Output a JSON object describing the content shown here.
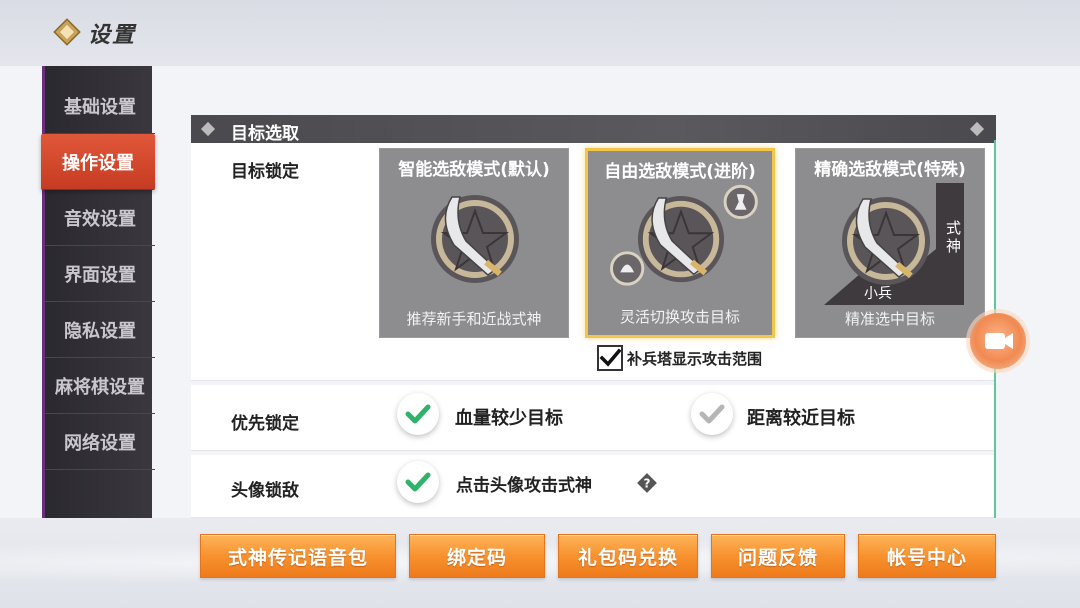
{
  "header": {
    "title": "设置",
    "logo_icon": "diamond-logo-icon"
  },
  "sidebar": {
    "items": [
      {
        "label": "基础设置",
        "active": false
      },
      {
        "label": "操作设置",
        "active": true
      },
      {
        "label": "音效设置",
        "active": false
      },
      {
        "label": "界面设置",
        "active": false
      },
      {
        "label": "隐私设置",
        "active": false
      },
      {
        "label": "麻将棋设置",
        "active": false
      },
      {
        "label": "网络设置",
        "active": false
      }
    ]
  },
  "section": {
    "title": "目标选取"
  },
  "target_lock": {
    "label": "目标锁定",
    "modes": [
      {
        "title": "智能选敌模式(默认)",
        "desc": "推荐新手和近战式神",
        "selected": false
      },
      {
        "title": "自由选敌模式(进阶)",
        "desc": "灵活切换攻击目标",
        "selected": true
      },
      {
        "title": "精确选敌模式(特殊)",
        "desc": "精准选中目标",
        "selected": false,
        "tag_top": "式神",
        "tag_bottom": "小兵"
      }
    ],
    "tower_range": {
      "label": "补兵塔显示攻击范围",
      "checked": true
    }
  },
  "priority_lock": {
    "label": "优先锁定",
    "options": [
      {
        "label": "血量较少目标",
        "checked": true
      },
      {
        "label": "距离较近目标",
        "checked": false
      }
    ]
  },
  "avatar_lock": {
    "label": "头像锁敌",
    "option": {
      "label": "点击头像攻击式神",
      "checked": true
    }
  },
  "bottom_buttons": [
    {
      "label": "式神传记语音包"
    },
    {
      "label": "绑定码"
    },
    {
      "label": "礼包码兑换"
    },
    {
      "label": "问题反馈"
    },
    {
      "label": "帐号中心"
    }
  ],
  "colors": {
    "accent_orange": "#f7922e",
    "active_tab": "#d94a2e",
    "selected_border": "#f3c54a",
    "check_green": "#2fb36b",
    "check_gray": "#b5b5b5"
  }
}
